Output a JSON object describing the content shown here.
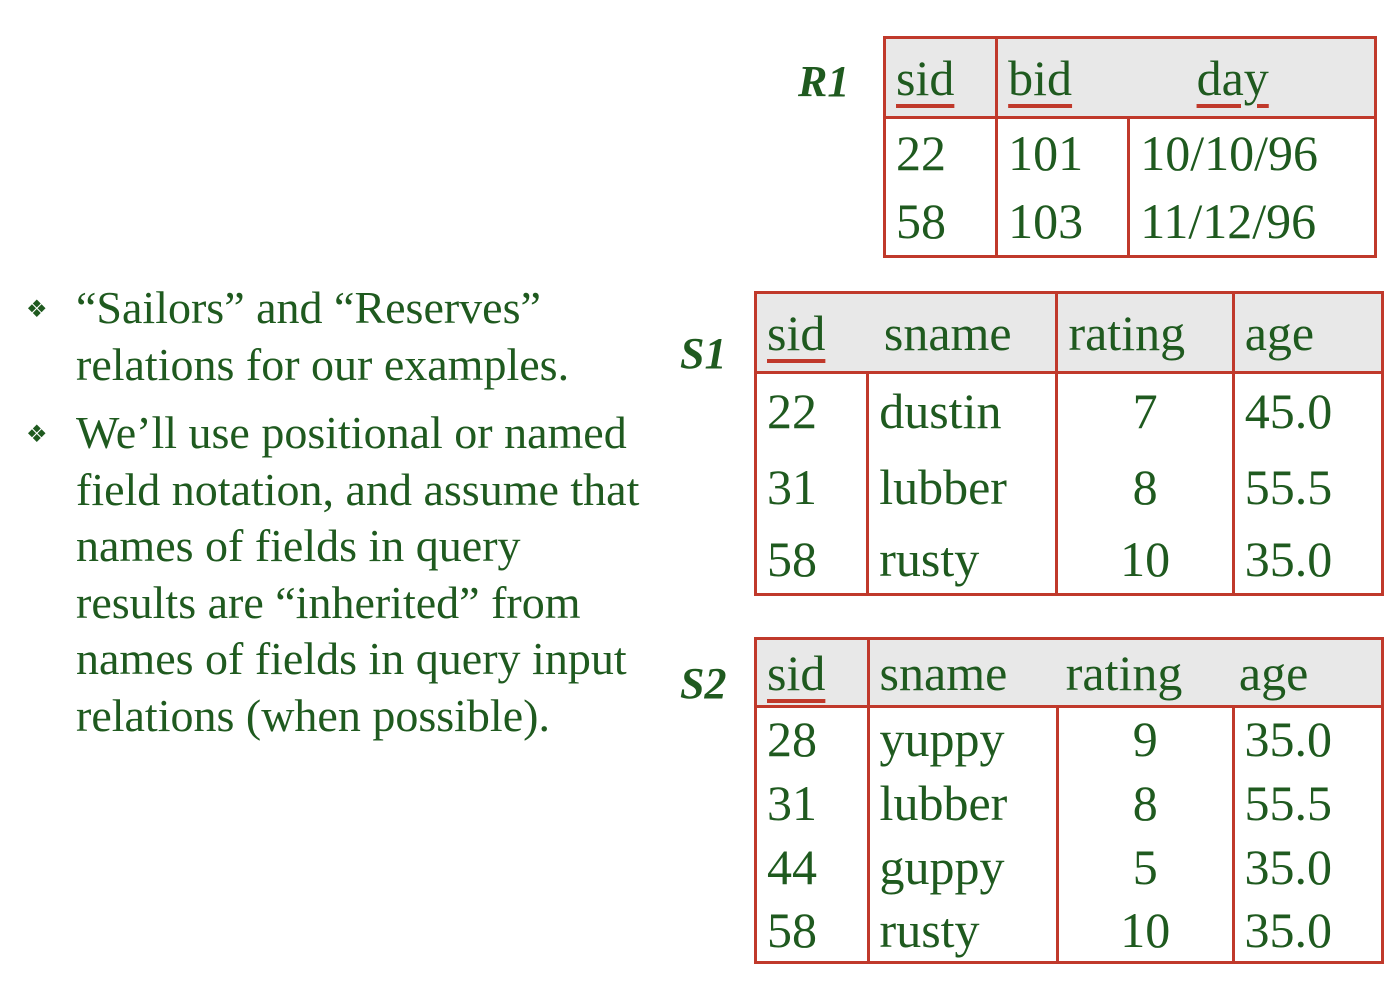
{
  "bullets": [
    "“Sailors” and “Reserves” relations for our examples.",
    "We’ll use positional or named field notation, and assume that names of fields in query results are “inherited” from names of fields in query input relations (when possible)."
  ],
  "bullet_icon": "diamond-bullet-icon",
  "r1": {
    "label": "R1",
    "headers": [
      "sid",
      "bid",
      "day"
    ],
    "rows": [
      [
        "22",
        "101",
        "10/10/96"
      ],
      [
        "58",
        "103",
        "11/12/96"
      ]
    ]
  },
  "s1": {
    "label": "S1",
    "headers": [
      "sid",
      "sname",
      "rating",
      "age"
    ],
    "rows": [
      [
        "22",
        "dustin",
        "7",
        "45.0"
      ],
      [
        "31",
        "lubber",
        "8",
        "55.5"
      ],
      [
        "58",
        "rusty",
        "10",
        "35.0"
      ]
    ]
  },
  "s2": {
    "label": "S2",
    "headers": [
      "sid",
      "sname",
      "rating",
      "age"
    ],
    "rows": [
      [
        "28",
        "yuppy",
        "9",
        "35.0"
      ],
      [
        "31",
        "lubber",
        "8",
        "55.5"
      ],
      [
        "44",
        "guppy",
        "5",
        "35.0"
      ],
      [
        "58",
        "rusty",
        "10",
        "35.0"
      ]
    ]
  },
  "colors": {
    "text": "#1f5a1f",
    "border": "#c0392b",
    "header_bg": "#e8e8e8"
  }
}
